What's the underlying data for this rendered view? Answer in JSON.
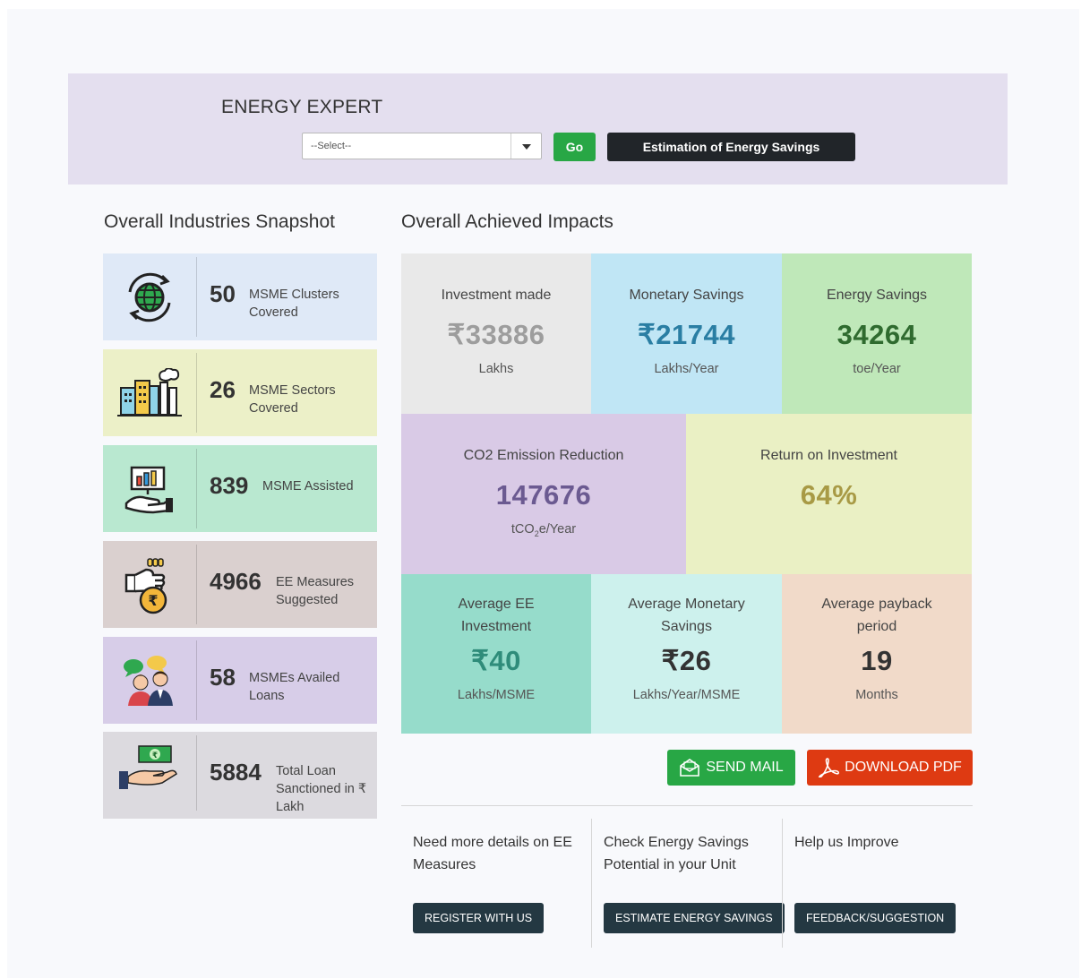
{
  "header": {
    "title": "ENERGY EXPERT",
    "select_value": "--Select--",
    "go_label": "Go",
    "estimate_label": "Estimation of Energy Savings"
  },
  "snapshot": {
    "title": "Overall Industries Snapshot",
    "items": [
      {
        "value": "50",
        "label": "MSME Clusters Covered",
        "icon": "globe-cycle-icon",
        "color": "#dfe9f7"
      },
      {
        "value": "26",
        "label": "MSME Sectors Covered",
        "icon": "factory-icon",
        "color": "#ecf0c8"
      },
      {
        "value": "839",
        "label": "MSME Assisted",
        "icon": "hand-chart-icon",
        "color": "#b9e8d0"
      },
      {
        "value": "4966",
        "label": "EE Measures Suggested",
        "icon": "money-bag-rupee-icon",
        "color": "#dad0cf"
      },
      {
        "value": "58",
        "label": "MSMEs Availed Loans",
        "icon": "people-chat-icon",
        "color": "#d7cde8"
      },
      {
        "value": "5884",
        "label": "Total Loan Sanctioned in ₹ Lakh",
        "icon": "hand-banknote-icon",
        "color": "#dcdadf"
      }
    ]
  },
  "impacts": {
    "title": "Overall Achieved Impacts",
    "investment": {
      "label": "Investment made",
      "value": "₹33886",
      "unit": "Lakhs"
    },
    "monetary": {
      "label": "Monetary Savings",
      "value": "₹21744",
      "unit": "Lakhs/Year"
    },
    "energy": {
      "label": "Energy Savings",
      "value": "34264",
      "unit": "toe/Year"
    },
    "co2": {
      "label": "CO2 Emission Reduction",
      "value": "147676",
      "unit_pre": "tCO",
      "unit_sub": "2",
      "unit_post": "e/Year"
    },
    "roi": {
      "label": "Return on Investment",
      "value": "64%"
    },
    "avg_ee": {
      "label_1": "Average EE",
      "label_2": "Investment",
      "value": "₹40",
      "unit": "Lakhs/MSME"
    },
    "avg_monetary": {
      "label_1": "Average Monetary",
      "label_2": "Savings",
      "value": "₹26",
      "unit": "Lakhs/Year/MSME"
    },
    "avg_payback": {
      "label_1": "Average payback",
      "label_2": "period",
      "value": "19",
      "unit": "Months"
    }
  },
  "actions": {
    "send_mail": "SEND MAIL",
    "download_pdf": "DOWNLOAD PDF"
  },
  "footer": {
    "col1": {
      "text": "Need more details on EE Measures",
      "button": "REGISTER WITH US"
    },
    "col2": {
      "text": "Check Energy Savings Potential in your Unit",
      "button": "ESTIMATE ENERGY SAVINGS"
    },
    "col3": {
      "text": "Help us Improve",
      "button": "FEEDBACK/SUGGESTION"
    }
  },
  "colors": {
    "investment_bg": "#e9e9e9",
    "investment_fg": "#9d9d9d",
    "monetary_bg": "#c0e6f5",
    "monetary_fg": "#2a7ea3",
    "energy_bg": "#bfe8b9",
    "energy_fg": "#2f6b2f",
    "co2_bg": "#d9cae6",
    "co2_fg": "#6b5a91",
    "roi_bg": "#eaf0c4",
    "roi_fg": "#a89a45",
    "avg_ee_bg": "#96dccb",
    "avg_ee_fg": "#2f8c7a",
    "avg_monetary_bg": "#cdf1ed",
    "avg_monetary_fg": "#333333",
    "avg_payback_bg": "#f1dac9",
    "avg_payback_fg": "#333333",
    "send_mail": "#28a745",
    "download_pdf": "#de3a12"
  }
}
